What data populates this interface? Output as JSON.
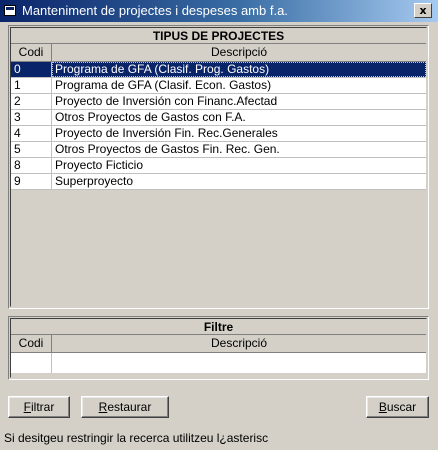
{
  "window": {
    "title": "Manteniment de projectes i despeses amb f.a.",
    "close_glyph": "x"
  },
  "projects": {
    "title": "TIPUS DE PROJECTES",
    "col_codi": "Codi",
    "col_desc": "Descripció",
    "selected_index": 0,
    "rows": [
      {
        "codi": "0",
        "desc": "Programa de GFA (Clasif. Prog. Gastos)"
      },
      {
        "codi": "1",
        "desc": "Programa de GFA (Clasif. Econ. Gastos)"
      },
      {
        "codi": "2",
        "desc": "Proyecto de Inversión con Financ.Afectad"
      },
      {
        "codi": "3",
        "desc": "Otros Proyectos de Gastos con F.A."
      },
      {
        "codi": "4",
        "desc": "Proyecto de Inversión Fin. Rec.Generales"
      },
      {
        "codi": "5",
        "desc": "Otros Proyectos de Gastos Fin. Rec. Gen."
      },
      {
        "codi": "8",
        "desc": "Proyecto Ficticio"
      },
      {
        "codi": "9",
        "desc": "Superproyecto"
      }
    ]
  },
  "filter": {
    "title": "Filtre",
    "col_codi": "Codi",
    "col_desc": "Descripció",
    "codi_value": "",
    "desc_value": ""
  },
  "buttons": {
    "filtrar_first": "F",
    "filtrar_rest": "iltrar",
    "restaurar_first": "R",
    "restaurar_rest": "estaurar",
    "buscar_first": "B",
    "buscar_rest": "uscar"
  },
  "status": {
    "text": "Si desitgeu restringir la recerca utilitzeu l¿asterisc"
  }
}
